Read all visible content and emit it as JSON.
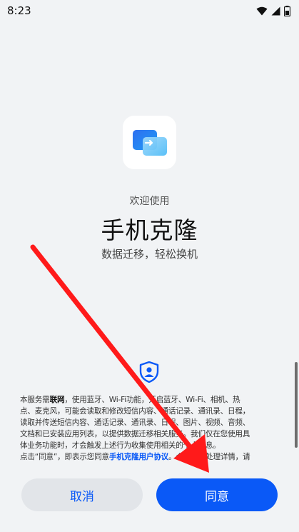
{
  "status_bar": {
    "time": "8:23",
    "icons": [
      "wifi-icon",
      "signal-icon",
      "battery-icon"
    ]
  },
  "app": {
    "icon": "phone-clone-app-icon",
    "welcome": "欢迎使用",
    "title": "手机克隆",
    "subtitle": "数据迁移，轻松换机"
  },
  "notice": {
    "icon": "privacy-shield-icon",
    "lines": [
      [
        "本服务需",
        "联网",
        "，使用蓝牙、Wi-Fi功能，开启蓝牙、Wi-Fi、相机、热"
      ],
      "点、麦克风，可能会读取和修改短信内容、通话记录、通讯录、日程，",
      "读取并传送短信内容、通话记录、通讯录、日程、图片、视频、音频、",
      "文档和已安装应用列表，以提供数据迁移相关服务。我们仅在您使用具",
      "体业务功能时，才会触发上述行为收集使用相关的个人信息。",
      [
        "点击“同意”，即表示您同意",
        "手机克隆用户协议",
        "。个人信息处理详情，请"
      ]
    ]
  },
  "buttons": {
    "cancel": "取消",
    "agree": "同意"
  },
  "colors": {
    "accent": "#0a59f7",
    "annotation_arrow": "#ff1a1a",
    "background": "#f1f3f5"
  }
}
